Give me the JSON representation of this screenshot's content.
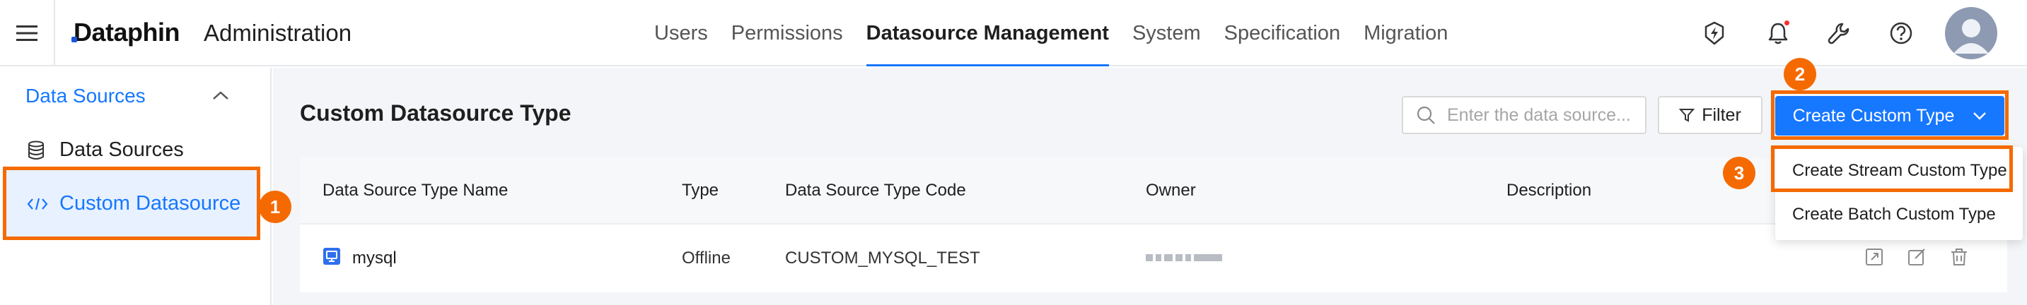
{
  "header": {
    "logo_text": "Dataphin",
    "app_title": "Administration",
    "nav": [
      "Users",
      "Permissions",
      "Datasource Management",
      "System",
      "Specification",
      "Migration"
    ],
    "active_nav": "Datasource Management"
  },
  "sidebar": {
    "group_label": "Data Sources",
    "items": [
      {
        "label": "Data Sources"
      },
      {
        "label": "Custom Datasource"
      }
    ]
  },
  "main": {
    "title": "Custom Datasource Type",
    "search_placeholder": "Enter the data source...",
    "filter_label": "Filter",
    "create_label": "Create Custom Type",
    "table": {
      "columns": [
        "Data Source Type Name",
        "Type",
        "Data Source Type Code",
        "Owner",
        "Description"
      ],
      "rows": [
        {
          "name": "mysql",
          "type": "Offline",
          "code": "CUSTOM_MYSQL_TEST",
          "owner": "",
          "description": ""
        }
      ]
    },
    "dropdown": [
      "Create Stream Custom Type",
      "Create Batch Custom Type"
    ]
  },
  "annotations": [
    "1",
    "2",
    "3"
  ],
  "colors": {
    "accent": "#1677ff",
    "highlight": "#f56a00",
    "sidebar_active_bg": "#e8f1ff",
    "notification": "#ff2b2b"
  },
  "icons": [
    "menu-icon",
    "bolt-icon",
    "bell-icon",
    "wrench-icon",
    "help-icon",
    "avatar-icon",
    "chevron-up-icon",
    "database-icon",
    "code-icon",
    "search-icon",
    "filter-icon",
    "chevron-down-icon",
    "datasource-type-icon",
    "export-icon",
    "edit-icon",
    "delete-icon"
  ]
}
